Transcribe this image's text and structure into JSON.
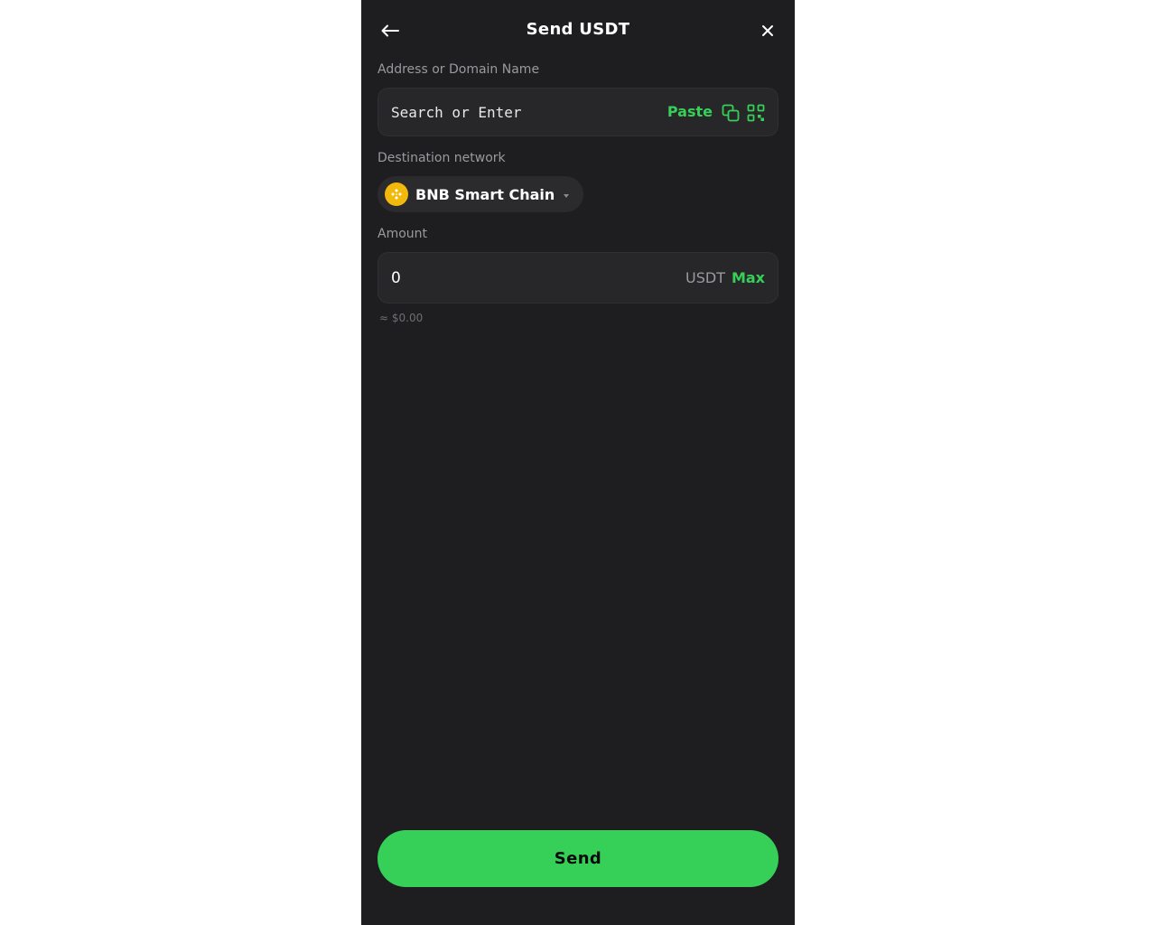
{
  "header": {
    "title": "Send USDT",
    "back_icon": "arrow-left-icon",
    "close_icon": "close-icon"
  },
  "address": {
    "label": "Address or Domain Name",
    "value": "",
    "placeholder": "Search or Enter",
    "paste_label": "Paste",
    "copy_icon": "copy-icon",
    "qr_icon": "qr-code-icon"
  },
  "network": {
    "label": "Destination network",
    "selected": "BNB Smart Chain",
    "logo_icon": "bnb-logo-icon",
    "caret_icon": "chevron-down-icon"
  },
  "amount": {
    "label": "Amount",
    "value": "0",
    "currency": "USDT",
    "max_label": "Max",
    "fiat_estimate": "≈ $0.00"
  },
  "actions": {
    "send_label": "Send"
  },
  "colors": {
    "accent": "#36d058",
    "background": "#1e1e20",
    "field": "#27272a",
    "bnb": "#f0b90b"
  }
}
